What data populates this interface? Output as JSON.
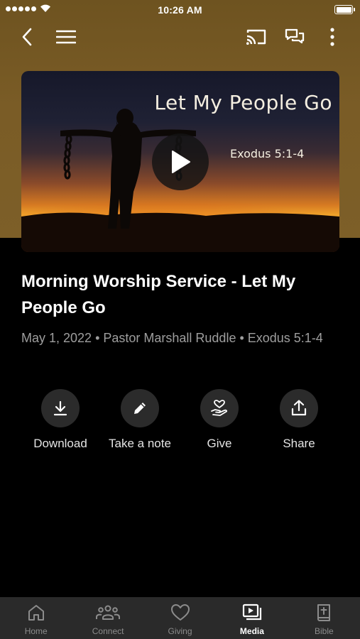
{
  "status_bar": {
    "time": "10:26 AM"
  },
  "hero": {
    "overlay_title": "Let My People Go",
    "overlay_reference": "Exodus 5:1-4"
  },
  "sermon": {
    "title": "Morning Worship Service - Let My People Go",
    "meta": "May 1, 2022 • Pastor Marshall Ruddle • Exodus 5:1-4"
  },
  "actions": [
    {
      "label": "Download",
      "icon": "download-icon"
    },
    {
      "label": "Take a note",
      "icon": "pencil-icon"
    },
    {
      "label": "Give",
      "icon": "give-heart-hand-icon"
    },
    {
      "label": "Share",
      "icon": "share-icon"
    }
  ],
  "tabs": [
    {
      "label": "Home",
      "icon": "home-icon",
      "active": false
    },
    {
      "label": "Connect",
      "icon": "people-icon",
      "active": false
    },
    {
      "label": "Giving",
      "icon": "heart-icon",
      "active": false
    },
    {
      "label": "Media",
      "icon": "media-icon",
      "active": true
    },
    {
      "label": "Bible",
      "icon": "bible-icon",
      "active": false
    }
  ],
  "colors": {
    "header_brown": "#7a5c26",
    "background": "#000000",
    "tab_bar": "#2a2a2a",
    "action_circle": "#2b2b2b",
    "meta_text": "#9e9e9e"
  }
}
